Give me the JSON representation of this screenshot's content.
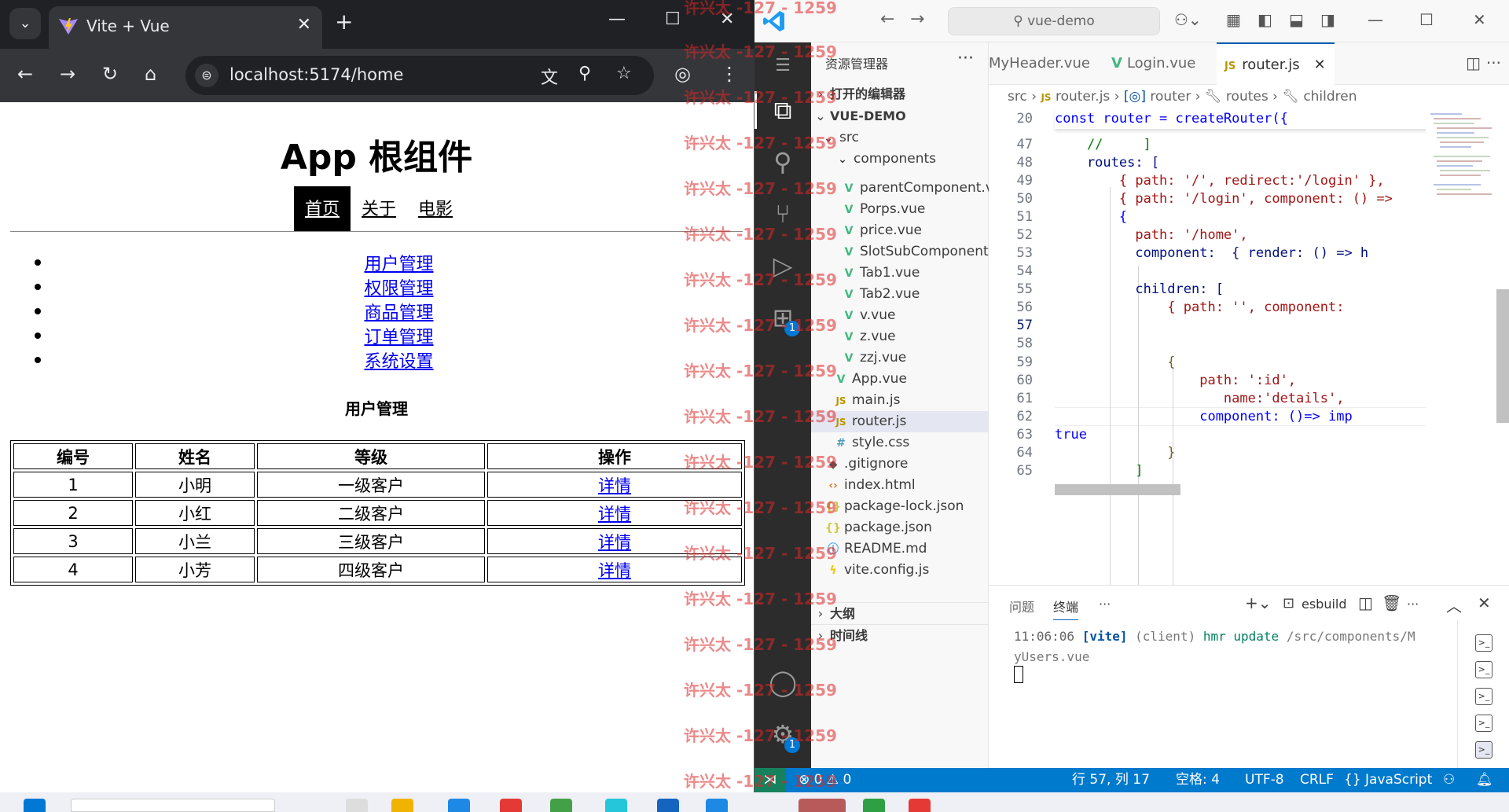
{
  "browser": {
    "tab_title": "Vite + Vue",
    "tab_close": "✕",
    "new_tab": "+",
    "url": "localhost:5174/home",
    "win_min": "—",
    "win_max": "☐",
    "win_close": "✕"
  },
  "page": {
    "heading": "App 根组件",
    "nav": [
      {
        "label": "首页",
        "active": true
      },
      {
        "label": "关于"
      },
      {
        "label": "电影"
      }
    ],
    "menu": [
      "用户管理",
      "权限管理",
      "商品管理",
      "订单管理",
      "系统设置"
    ],
    "section_title": "用户管理",
    "table": {
      "headers": [
        "编号",
        "姓名",
        "等级",
        "操作"
      ],
      "rows": [
        [
          "1",
          "小明",
          "一级客户",
          "详情"
        ],
        [
          "2",
          "小红",
          "二级客户",
          "详情"
        ],
        [
          "3",
          "小兰",
          "三级客户",
          "详情"
        ],
        [
          "4",
          "小芳",
          "四级客户",
          "详情"
        ]
      ]
    }
  },
  "vscode": {
    "search": "vue-demo",
    "explorer_title": "资源管理器",
    "open_editors": "打开的编辑器",
    "project": "VUE-DEMO",
    "folders": {
      "src": "src",
      "components": "components"
    },
    "files": [
      {
        "name": "parentComponent.v...",
        "type": "vue"
      },
      {
        "name": "Porps.vue",
        "type": "vue"
      },
      {
        "name": "price.vue",
        "type": "vue"
      },
      {
        "name": "SlotSubComponent....",
        "type": "vue"
      },
      {
        "name": "Tab1.vue",
        "type": "vue"
      },
      {
        "name": "Tab2.vue",
        "type": "vue"
      },
      {
        "name": "v.vue",
        "type": "vue"
      },
      {
        "name": "z.vue",
        "type": "vue"
      },
      {
        "name": "zzj.vue",
        "type": "vue"
      },
      {
        "name": "App.vue",
        "type": "vue"
      },
      {
        "name": "main.js",
        "type": "js"
      },
      {
        "name": "router.js",
        "type": "js",
        "selected": true
      },
      {
        "name": "style.css",
        "type": "css"
      },
      {
        "name": ".gitignore",
        "type": "git"
      },
      {
        "name": "index.html",
        "type": "html"
      },
      {
        "name": "package-lock.json",
        "type": "json"
      },
      {
        "name": "package.json",
        "type": "json"
      },
      {
        "name": "README.md",
        "type": "info"
      },
      {
        "name": "vite.config.js",
        "type": "vite"
      }
    ],
    "outline": "大纲",
    "timeline": "时间线",
    "tabs": [
      {
        "label": "MyHeader.vue",
        "type": "vue"
      },
      {
        "label": "Login.vue",
        "type": "vue"
      },
      {
        "label": "router.js",
        "type": "js",
        "active": true
      }
    ],
    "breadcrumb": [
      "src",
      "router.js",
      "router",
      "routes",
      "children"
    ],
    "code_lines": [
      {
        "n": "20",
        "t": "const router = createRouter({"
      },
      {
        "n": "47",
        "t": "    //     ]"
      },
      {
        "n": "48",
        "t": "    routes: ["
      },
      {
        "n": "49",
        "t": "        { path: '/', redirect:'/login' },"
      },
      {
        "n": "50",
        "t": "        { path: '/login', component: () =>"
      },
      {
        "n": "51",
        "t": "        {"
      },
      {
        "n": "52",
        "t": "          path: '/home',"
      },
      {
        "n": "53",
        "t": "          component:  { render: () => h"
      },
      {
        "n": "54",
        "t": ""
      },
      {
        "n": "55",
        "t": "          children: ["
      },
      {
        "n": "56",
        "t": "              { path: '', component:"
      },
      {
        "n": "57",
        "t": ""
      },
      {
        "n": "58",
        "t": ""
      },
      {
        "n": "59",
        "t": "              {"
      },
      {
        "n": "60",
        "t": "                  path: ':id',"
      },
      {
        "n": "61",
        "t": "                     name:'details',"
      },
      {
        "n": "62",
        "t": "                  component: ()=> imp"
      },
      {
        "n": "63",
        "t": "true"
      },
      {
        "n": "64",
        "t": "              }"
      },
      {
        "n": "65",
        "t": "          ]"
      }
    ],
    "panel": {
      "tabs": [
        "问题",
        "终端"
      ],
      "task": "esbuild",
      "term_time": "11:06:06",
      "term_tag": "[vite]",
      "term_client": "(client)",
      "term_msg": "hmr update",
      "term_path": "/src/components/MyUsers.vue"
    },
    "status": {
      "errors": "0",
      "warnings": "0",
      "position": "行 57, 列 17",
      "spaces": "空格: 4",
      "encoding": "UTF-8",
      "eol": "CRLF",
      "language": "JavaScript"
    },
    "badges": {
      "extensions": "1",
      "settings": "1"
    }
  },
  "watermark": "许兴太 -127 - 1259",
  "colors": {
    "vscode_accent": "#007acc",
    "vue_green": "#41b883",
    "link": "#0000ee"
  }
}
